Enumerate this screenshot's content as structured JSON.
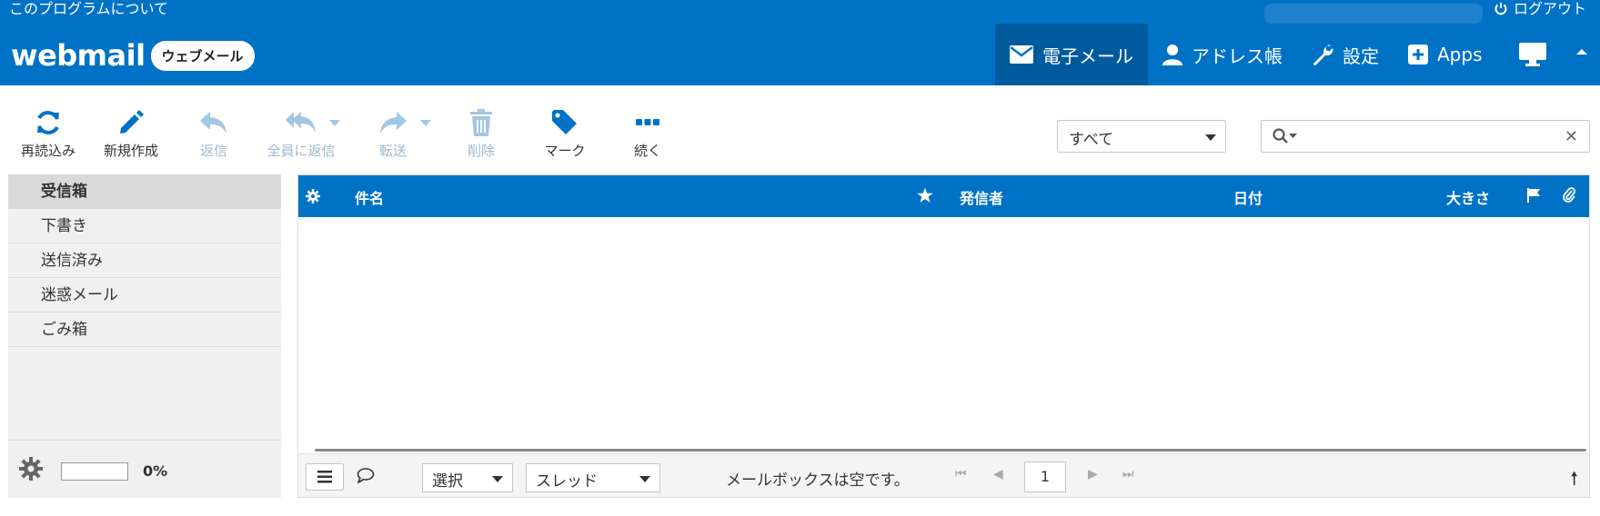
{
  "header": {
    "about": "このプログラムについて",
    "logout": "ログアウト",
    "logo_text": "webmail",
    "logo_badge": "ウェブメール",
    "nav": {
      "mail": "電子メール",
      "contacts": "アドレス帳",
      "settings": "設定",
      "apps": "Apps"
    }
  },
  "toolbar": {
    "refresh": "再読込み",
    "compose": "新規作成",
    "reply": "返信",
    "reply_all": "全員に返信",
    "forward": "転送",
    "delete": "削除",
    "mark": "マーク",
    "more": "続く"
  },
  "filter": {
    "selected": "すべて"
  },
  "search": {
    "value": ""
  },
  "folders": [
    {
      "label": "受信箱",
      "selected": true
    },
    {
      "label": "下書き"
    },
    {
      "label": "送信済み"
    },
    {
      "label": "迷惑メール"
    },
    {
      "label": "ごみ箱"
    }
  ],
  "quota": {
    "text": "0%",
    "fraction": 0
  },
  "messagelist": {
    "columns": {
      "subject": "件名",
      "from": "発信者",
      "date": "日付",
      "size": "大きさ"
    },
    "footer": {
      "select": "選択",
      "threads": "スレッド",
      "status": "メールボックスは空です。",
      "page": "1"
    }
  },
  "colors": {
    "brand": "#0072c6",
    "brand_dark": "#005a9e"
  }
}
